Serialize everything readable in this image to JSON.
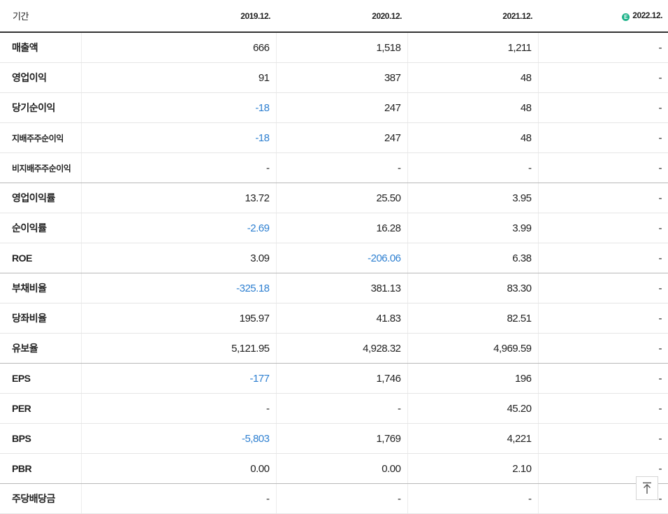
{
  "table": {
    "header": {
      "period_label": "기간",
      "years": [
        "2019.12.",
        "2020.12.",
        "2021.12.",
        "2022.12."
      ],
      "estimate_badge": "E"
    },
    "rows": [
      {
        "label": "매출액",
        "values": [
          "666",
          "1,518",
          "1,211",
          "-"
        ]
      },
      {
        "label": "영업이익",
        "values": [
          "91",
          "387",
          "48",
          "-"
        ]
      },
      {
        "label": "당기순이익",
        "values": [
          "-18",
          "247",
          "48",
          "-"
        ]
      },
      {
        "label": "지배주주순이익",
        "values": [
          "-18",
          "247",
          "48",
          "-"
        ]
      },
      {
        "label": "비지배주주순이익",
        "values": [
          "-",
          "-",
          "-",
          "-"
        ]
      },
      {
        "label": "영업이익률",
        "values": [
          "13.72",
          "25.50",
          "3.95",
          "-"
        ]
      },
      {
        "label": "순이익률",
        "values": [
          "-2.69",
          "16.28",
          "3.99",
          "-"
        ]
      },
      {
        "label": "ROE",
        "values": [
          "3.09",
          "-206.06",
          "6.38",
          "-"
        ]
      },
      {
        "label": "부채비율",
        "values": [
          "-325.18",
          "381.13",
          "83.30",
          "-"
        ]
      },
      {
        "label": "당좌비율",
        "values": [
          "195.97",
          "41.83",
          "82.51",
          "-"
        ]
      },
      {
        "label": "유보율",
        "values": [
          "5,121.95",
          "4,928.32",
          "4,969.59",
          "-"
        ]
      },
      {
        "label": "EPS",
        "values": [
          "-177",
          "1,746",
          "196",
          "-"
        ]
      },
      {
        "label": "PER",
        "values": [
          "-",
          "-",
          "45.20",
          "-"
        ]
      },
      {
        "label": "BPS",
        "values": [
          "-5,803",
          "1,769",
          "4,221",
          "-"
        ]
      },
      {
        "label": "PBR",
        "values": [
          "0.00",
          "0.00",
          "2.10",
          "-"
        ]
      },
      {
        "label": "주당배당금",
        "values": [
          "-",
          "-",
          "-",
          "-"
        ]
      }
    ]
  },
  "colors": {
    "negative": "#2f80d1",
    "estimate_badge": "#1fb38a"
  },
  "icons": {
    "scroll_top": "arrow-up-to-line-icon"
  }
}
